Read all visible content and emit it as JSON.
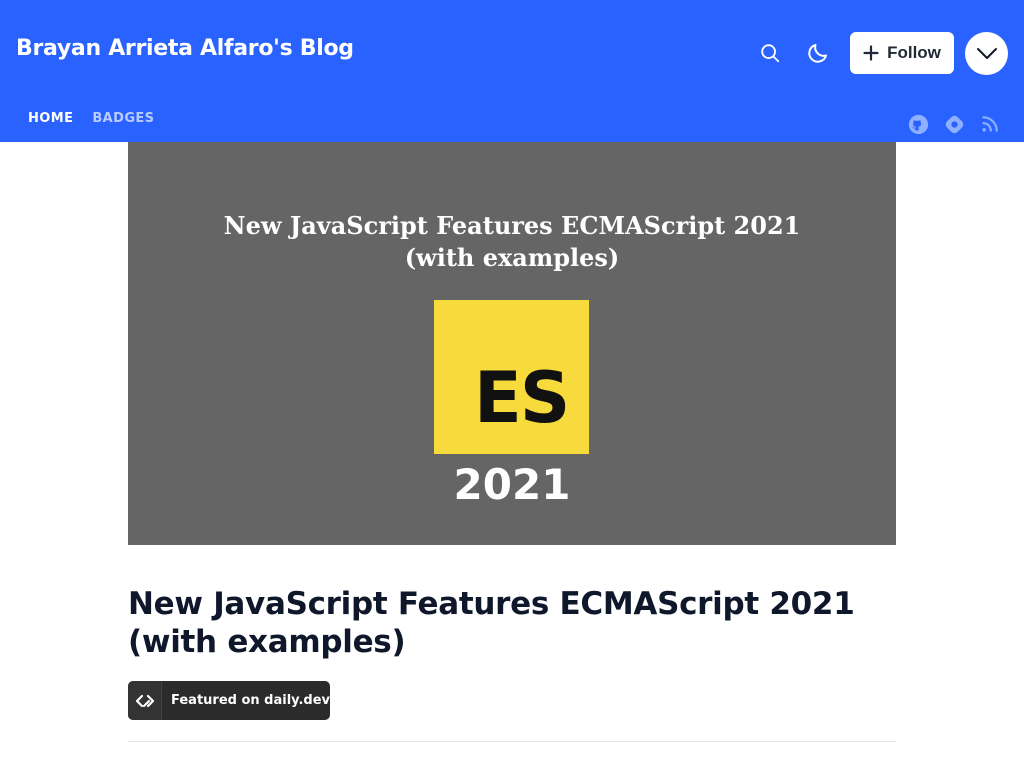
{
  "header": {
    "blog_title": "Brayan Arrieta Alfaro's Blog",
    "follow_label": "Follow",
    "background_color": "#2962ff",
    "icons": [
      "search-icon",
      "moon-icon",
      "plus-icon",
      "chevron-down-icon"
    ]
  },
  "nav": {
    "items": [
      {
        "label": "HOME",
        "active": true
      },
      {
        "label": "BADGES",
        "active": false
      }
    ],
    "social_icons": [
      "github-icon",
      "hashnode-icon",
      "rss-icon"
    ]
  },
  "cover": {
    "title_line1": "New JavaScript Features ECMAScript 2021",
    "title_line2": "(with examples)",
    "logo_text": "ES",
    "logo_year": "2021",
    "background_color": "#656565",
    "logo_color": "#f7db3c"
  },
  "post": {
    "title": "New JavaScript Features ECMAScript 2021 (with examples)",
    "badge_label": "Featured on daily.dev",
    "badge_icon": "daily-dev-icon"
  }
}
